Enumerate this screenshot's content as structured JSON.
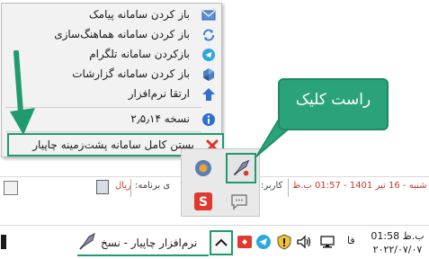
{
  "menu": {
    "items": [
      {
        "label": "باز کردن سامانه پیامک",
        "icon": "mail-icon"
      },
      {
        "label": "باز کردن سامانه هماهنگ‌سازی",
        "icon": "sync-icon"
      },
      {
        "label": "بازکردن سامانه تلگرام",
        "icon": "telegram-icon"
      },
      {
        "label": "باز کردن سامانه گزارشات",
        "icon": "report-icon"
      },
      {
        "label": "ارتقا نرم‌افزار",
        "icon": "upgrade-arrow-icon"
      },
      {
        "label": "نسخه ۲٫۵٫۱۴",
        "icon": "info-icon"
      },
      {
        "label": "بستن کامل سامانه پشت‌زمینه چاپیار",
        "icon": "close-x-icon"
      }
    ]
  },
  "callout": {
    "text": "راست کلیک"
  },
  "app_strip": {
    "date_text": "شنبه - 16 تیر 1401 - 01:57 ب.ظ",
    "user_text": "کاربر:",
    "program_text": "ی برنامه:",
    "currency_text": "ریال"
  },
  "taskbar": {
    "app_label": "نرم‌افزار چاپیار - نسخ",
    "language": "فا",
    "clock_time": "01:58 ب.ظ",
    "clock_date": "۲۰۲۲/۰۷/۰۷"
  },
  "colors": {
    "highlight_green": "#1f9b6e",
    "callout_green": "#2aa37a",
    "red_text": "#c0392b"
  }
}
